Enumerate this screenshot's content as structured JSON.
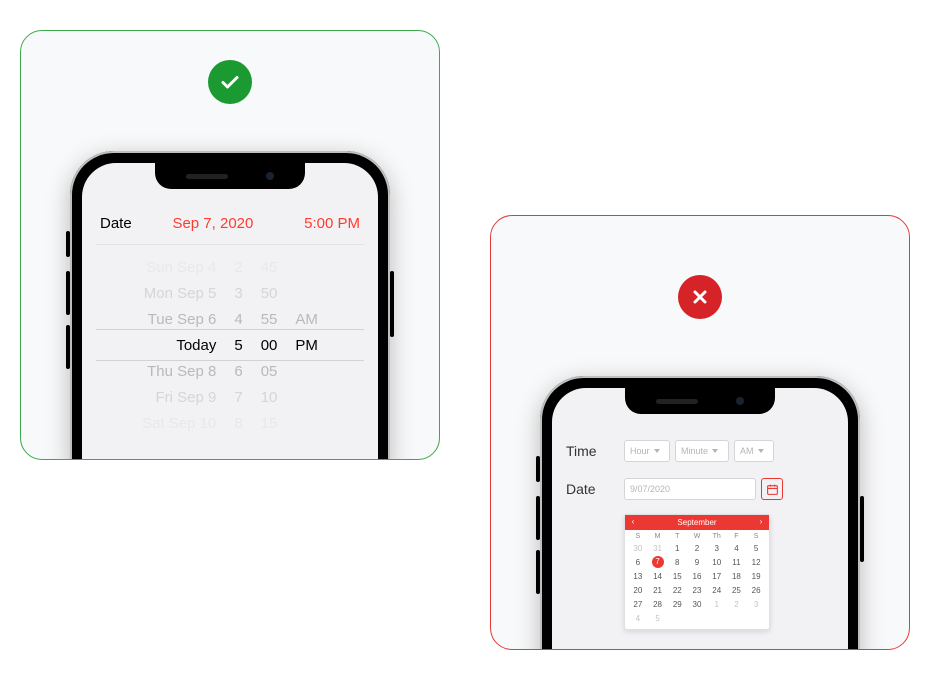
{
  "good": {
    "row_label": "Date",
    "row_date": "Sep 7, 2020",
    "row_time": "5:00 PM",
    "picker": {
      "dates": [
        "Sun Sep 4",
        "Mon Sep 5",
        "Tue Sep 6",
        "Today",
        "Thu Sep 8",
        "Fri Sep 9",
        "Sat Sep 10"
      ],
      "hours": [
        "2",
        "3",
        "4",
        "5",
        "6",
        "7",
        "8"
      ],
      "mins": [
        "45",
        "50",
        "55",
        "00",
        "05",
        "10",
        "15"
      ],
      "ampm": [
        "",
        "",
        "AM",
        "PM",
        "",
        "",
        ""
      ]
    }
  },
  "bad": {
    "time_label": "Time",
    "date_label": "Date",
    "hour_ph": "Hour",
    "minute_ph": "Minute",
    "ampm_ph": "AM",
    "date_value": "9/07/2020",
    "calendar": {
      "month": "September",
      "dow": [
        "S",
        "M",
        "T",
        "W",
        "Th",
        "F",
        "S"
      ],
      "weeks": [
        [
          {
            "d": "30",
            "m": true
          },
          {
            "d": "31",
            "m": true
          },
          {
            "d": "1"
          },
          {
            "d": "2"
          },
          {
            "d": "3"
          },
          {
            "d": "4"
          },
          {
            "d": "5"
          }
        ],
        [
          {
            "d": "6"
          },
          {
            "d": "7",
            "sel": true
          },
          {
            "d": "8"
          },
          {
            "d": "9"
          },
          {
            "d": "10"
          },
          {
            "d": "11"
          },
          {
            "d": "12"
          }
        ],
        [
          {
            "d": "13"
          },
          {
            "d": "14"
          },
          {
            "d": "15"
          },
          {
            "d": "16"
          },
          {
            "d": "17"
          },
          {
            "d": "18"
          },
          {
            "d": "19"
          }
        ],
        [
          {
            "d": "20"
          },
          {
            "d": "21"
          },
          {
            "d": "22"
          },
          {
            "d": "23"
          },
          {
            "d": "24"
          },
          {
            "d": "25"
          },
          {
            "d": "26"
          }
        ],
        [
          {
            "d": "27"
          },
          {
            "d": "28"
          },
          {
            "d": "29"
          },
          {
            "d": "30"
          },
          {
            "d": "1",
            "m": true
          },
          {
            "d": "2",
            "m": true
          },
          {
            "d": "3",
            "m": true
          }
        ],
        [
          {
            "d": "4",
            "m": true
          },
          {
            "d": "5",
            "m": true
          },
          {
            "d": "",
            "m": true
          },
          {
            "d": "",
            "m": true
          },
          {
            "d": "",
            "m": true
          },
          {
            "d": "",
            "m": true
          },
          {
            "d": "",
            "m": true
          }
        ]
      ]
    }
  }
}
